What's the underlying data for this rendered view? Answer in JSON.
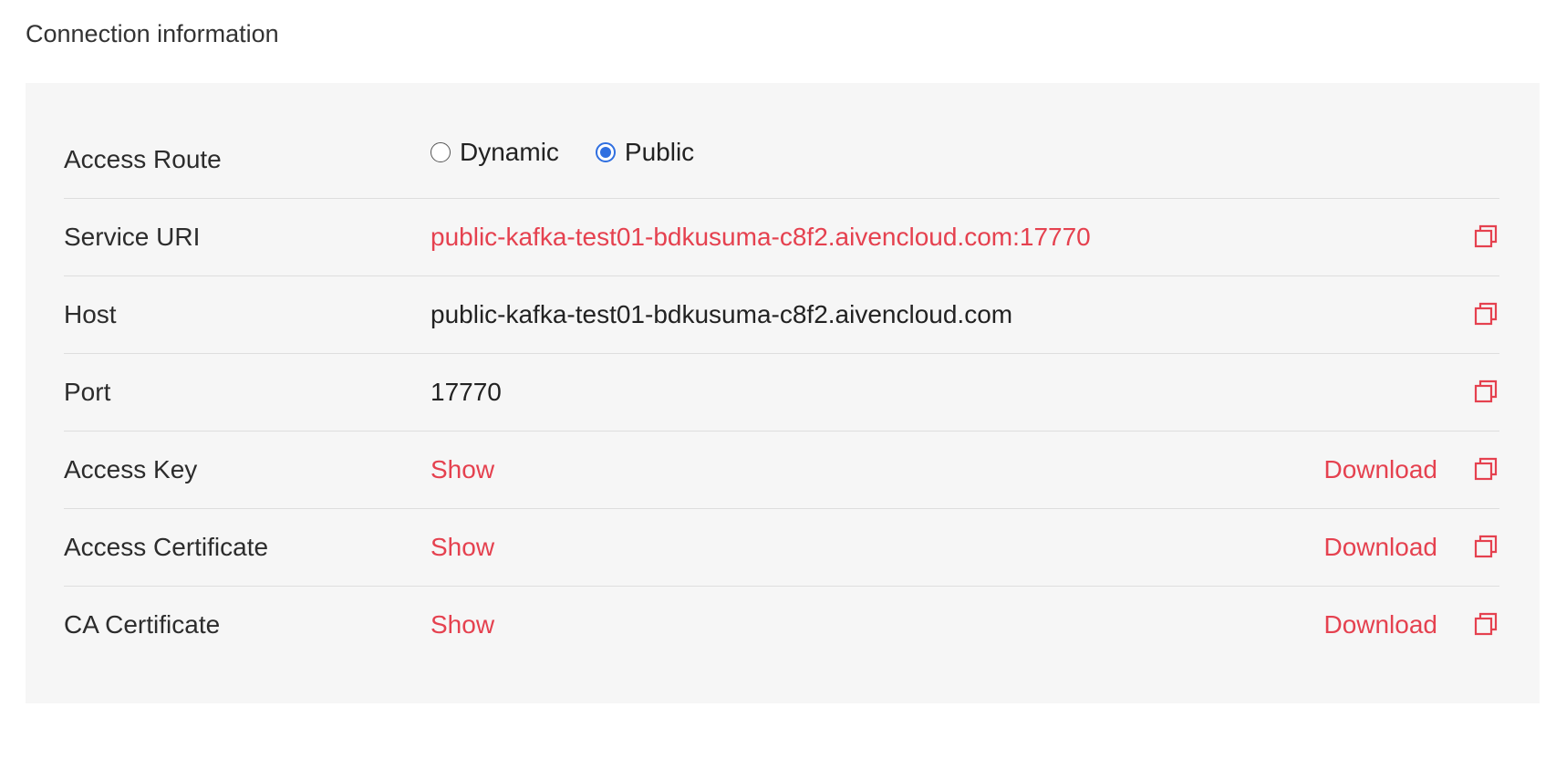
{
  "section": {
    "title": "Connection information"
  },
  "access_route": {
    "label": "Access Route",
    "options": [
      {
        "label": "Dynamic",
        "checked": false
      },
      {
        "label": "Public",
        "checked": true
      }
    ]
  },
  "rows": {
    "service_uri": {
      "label": "Service URI",
      "value": "public-kafka-test01-bdkusuma-c8f2.aivencloud.com:17770"
    },
    "host": {
      "label": "Host",
      "value": "public-kafka-test01-bdkusuma-c8f2.aivencloud.com"
    },
    "port": {
      "label": "Port",
      "value": "17770"
    },
    "access_key": {
      "label": "Access Key",
      "show": "Show",
      "download": "Download"
    },
    "access_certificate": {
      "label": "Access Certificate",
      "show": "Show",
      "download": "Download"
    },
    "ca_certificate": {
      "label": "CA Certificate",
      "show": "Show",
      "download": "Download"
    }
  },
  "colors": {
    "accent": "#e5414f",
    "radio": "#2f6fe0",
    "panel_bg": "#f6f6f6"
  },
  "icons": {
    "copy": "copy-icon"
  }
}
